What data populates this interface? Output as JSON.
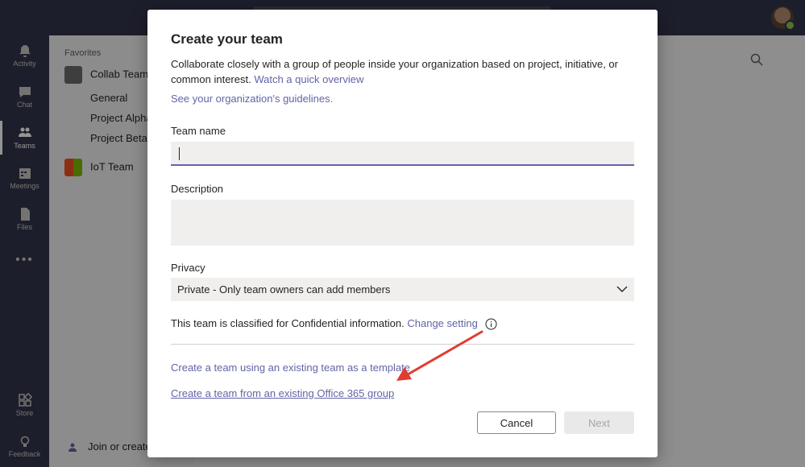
{
  "rail": {
    "items": [
      {
        "label": "Activity"
      },
      {
        "label": "Chat"
      },
      {
        "label": "Teams"
      },
      {
        "label": "Meetings"
      },
      {
        "label": "Files"
      },
      {
        "label": "Store"
      },
      {
        "label": "Feedback"
      }
    ]
  },
  "teams_panel": {
    "favorites_label": "Favorites",
    "teams": [
      {
        "name": "Collab Team",
        "channels": [
          "General",
          "Project Alpha",
          "Project Beta"
        ]
      },
      {
        "name": "IoT Team"
      }
    ],
    "join_label": "Join or create a team"
  },
  "dialog": {
    "title": "Create your team",
    "description": "Collaborate closely with a group of people inside your organization based on project, initiative, or common interest.",
    "overview_link": "Watch a quick overview",
    "guidelines_link": "See your organization's guidelines.",
    "team_name_label": "Team name",
    "team_name_value": "",
    "description_label": "Description",
    "privacy_label": "Privacy",
    "privacy_value": "Private - Only team owners can add members",
    "classification_text": "This team is classified for Confidential information.",
    "change_setting_link": "Change setting",
    "template_link": "Create a team using an existing team as a template",
    "o365_link": "Create a team from an existing Office 365 group",
    "cancel_label": "Cancel",
    "next_label": "Next"
  },
  "colors": {
    "accent": "#6264a7",
    "annotation_arrow": "#e03c31"
  }
}
